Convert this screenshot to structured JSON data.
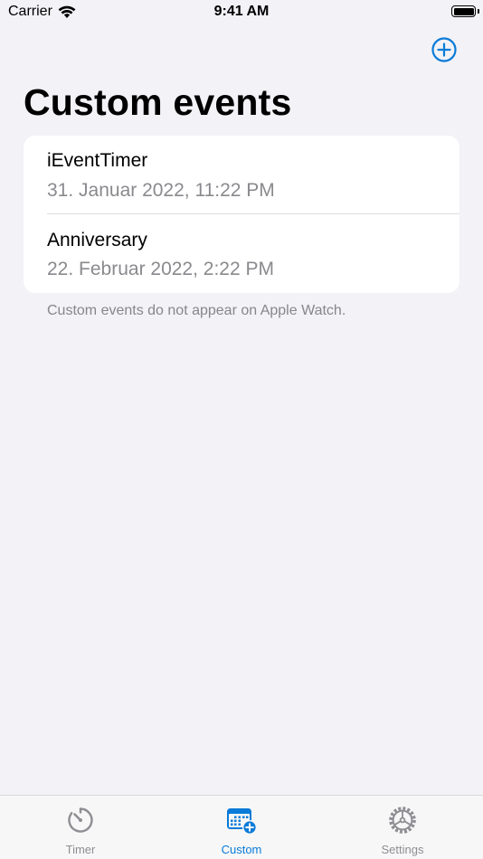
{
  "status_bar": {
    "carrier": "Carrier",
    "time": "9:41 AM"
  },
  "nav": {
    "add_icon": "plus-circle-icon",
    "accent_color": "#0a7bd8"
  },
  "page": {
    "title": "Custom events"
  },
  "events": [
    {
      "name": "iEventTimer",
      "date": "31. Januar 2022, 11:22 PM"
    },
    {
      "name": "Anniversary",
      "date": "22. Februar 2022, 2:22 PM"
    }
  ],
  "footer_note": "Custom events do not appear on Apple Watch.",
  "tab_bar": {
    "tabs": [
      {
        "label": "Timer",
        "icon": "timer-icon",
        "active": false
      },
      {
        "label": "Custom",
        "icon": "calendar-add-icon",
        "active": true
      },
      {
        "label": "Settings",
        "icon": "gear-icon",
        "active": false
      }
    ],
    "active_color": "#0a7bd8",
    "inactive_color": "#8e8e93"
  }
}
